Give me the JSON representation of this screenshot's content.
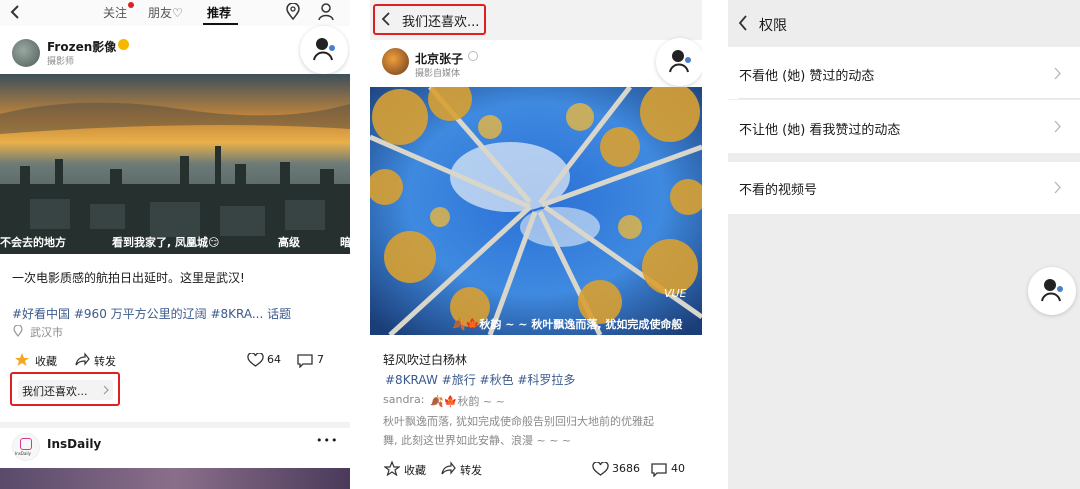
{
  "p1": {
    "tabs": [
      "关注",
      "朋友♡",
      "推荐"
    ],
    "author": {
      "name": "Frozen影像",
      "subtitle": "摄影师"
    },
    "subtitles": [
      "不会去的地方",
      "看到我家了, 凤凰城😏",
      "高级",
      "暗"
    ],
    "caption": "一次电影质感的航拍日出延时。这里是武汉!",
    "hashtags": "#好看中国  #960 万平方公里的辽阔 #8KRA... 话题",
    "location": "武汉市",
    "fav_label": "收藏",
    "share_label": "转发",
    "likes": "64",
    "comments": "7",
    "more_label": "我们还喜欢...",
    "next_author": "InsDaily",
    "next_avatar_text": "InsDaily",
    "more_dots": "•••"
  },
  "p2": {
    "header": "我们还喜欢...",
    "author": {
      "name": "北京张子",
      "subtitle": "摄影自媒体"
    },
    "watermark": "VUE",
    "overlay_caption": "🍂🍁秋韵 ~ ~ 秋叶飘逸而落, 犹如完成使命般",
    "title": "轻风吹过白杨林",
    "hashtags": "#8KRAW  #旅行  #秋色  #科罗拉多",
    "comment_user": "sandra:",
    "comment_text": "🍂🍁秋韵 ~ ~",
    "desc_line1": "秋叶飘逸而落, 犹如完成使命般告别回归大地前的优雅起",
    "desc_line2": "舞, 此刻这世界如此安静、浪漫 ~ ~ ~",
    "fav_label": "收藏",
    "share_label": "转发",
    "likes": "3686",
    "comments": "40"
  },
  "p3": {
    "title": "权限",
    "rows": [
      "不看他 (她) 赞过的动态",
      "不让他 (她) 看我赞过的动态",
      "不看的视频号"
    ]
  },
  "colors": {
    "accent_red": "#e02020",
    "link_blue": "#3b5a8c",
    "badge_gold": "#f5b800"
  }
}
